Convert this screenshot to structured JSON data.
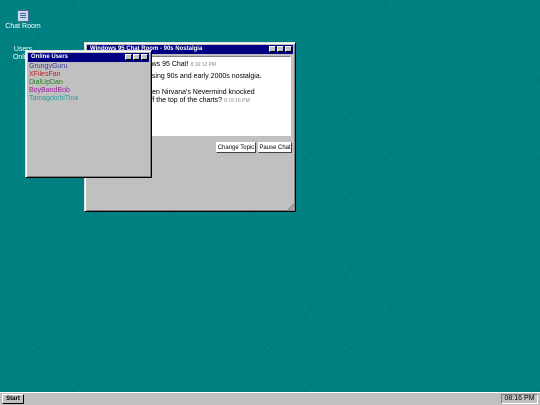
{
  "desktop": {
    "icons": [
      {
        "label": "Chat Room",
        "icon": "chat-window-icon"
      },
      {
        "label": "Users Online",
        "icon": "users-icon"
      }
    ]
  },
  "chat_window": {
    "title": "Windows 95 Chat Room - 90s Nostalgia",
    "messages": [
      {
        "text": "Welcome to Windows 95 Chat!",
        "time": "8:16:12 PM"
      },
      {
        "text": "Today we're discussing 90s and early 2000s nostalgia.",
        "time": ""
      },
      {
        "text": "Who remember when Nirvana's Nevermind knocked\nMichael Jackson off the top of the charts?",
        "time": "8:16:16 PM"
      }
    ],
    "buttons": {
      "change_topic": "Change Topic",
      "pause_chat": "Pause Chat"
    }
  },
  "users_window": {
    "title": "Online Users",
    "users": [
      {
        "name": "GrungyGuru",
        "color": "#3a3aa0"
      },
      {
        "name": "XFilesFan",
        "color": "#c02020"
      },
      {
        "name": "DialUpDan",
        "color": "#208020"
      },
      {
        "name": "BoyBandBob",
        "color": "#a020a0"
      },
      {
        "name": "TamagotchiTina",
        "color": "#20a0a0"
      }
    ]
  },
  "taskbar": {
    "start_label": "Start",
    "clock": "08:16 PM"
  },
  "colors": {
    "desktop": "#008080",
    "titlebar": "#000080",
    "window": "#c0c0c0"
  }
}
